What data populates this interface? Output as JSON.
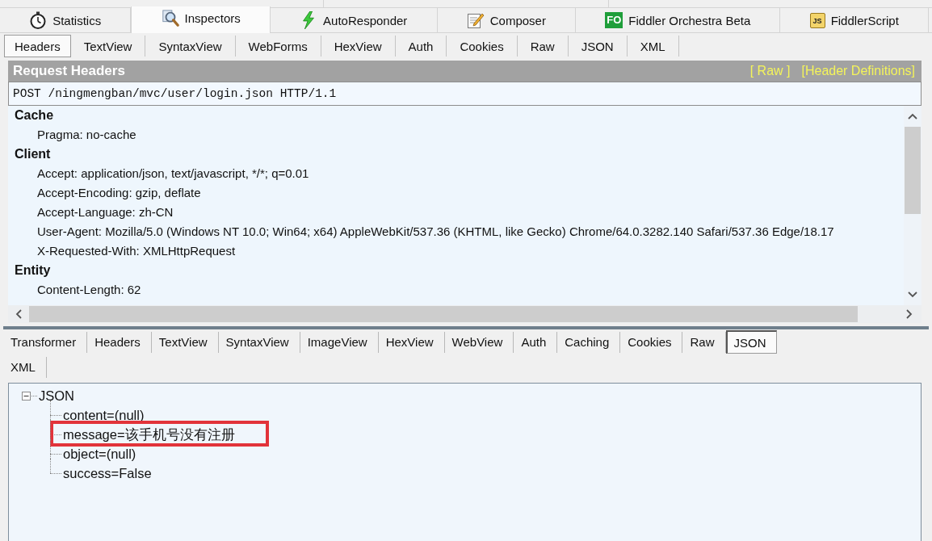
{
  "main_tabs": [
    {
      "label": "Statistics",
      "selected": false
    },
    {
      "label": "Inspectors",
      "selected": true
    },
    {
      "label": "AutoResponder",
      "selected": false
    },
    {
      "label": "Composer",
      "selected": false
    },
    {
      "label": "Fiddler Orchestra Beta",
      "badge": "FO",
      "selected": false
    },
    {
      "label": "FiddlerScript",
      "badge": "JS",
      "selected": false
    }
  ],
  "request_tabs": [
    {
      "label": "Headers",
      "selected": true
    },
    {
      "label": "TextView",
      "selected": false
    },
    {
      "label": "SyntaxView",
      "selected": false
    },
    {
      "label": "WebForms",
      "selected": false
    },
    {
      "label": "HexView",
      "selected": false
    },
    {
      "label": "Auth",
      "selected": false
    },
    {
      "label": "Cookies",
      "selected": false
    },
    {
      "label": "Raw",
      "selected": false
    },
    {
      "label": "JSON",
      "selected": false
    },
    {
      "label": "XML",
      "selected": false
    }
  ],
  "request_headers": {
    "title": "Request Headers",
    "links": [
      "[ Raw ]",
      "[Header Definitions]"
    ],
    "request_line": "POST /ningmengban/mvc/user/login.json HTTP/1.1",
    "groups": [
      {
        "name": "Cache",
        "headers": [
          "Pragma: no-cache"
        ]
      },
      {
        "name": "Client",
        "headers": [
          "Accept: application/json, text/javascript, */*; q=0.01",
          "Accept-Encoding: gzip, deflate",
          "Accept-Language: zh-CN",
          "User-Agent: Mozilla/5.0 (Windows NT 10.0; Win64; x64) AppleWebKit/537.36 (KHTML, like Gecko) Chrome/64.0.3282.140 Safari/537.36 Edge/18.17",
          "X-Requested-With: XMLHttpRequest"
        ]
      },
      {
        "name": "Entity",
        "headers": [
          "Content-Length: 62"
        ]
      }
    ]
  },
  "response_tabs": [
    {
      "tabs": [
        {
          "label": "Transformer",
          "selected": false
        },
        {
          "label": "Headers",
          "selected": false
        },
        {
          "label": "TextView",
          "selected": false
        },
        {
          "label": "SyntaxView",
          "selected": false
        },
        {
          "label": "ImageView",
          "selected": false
        },
        {
          "label": "HexView",
          "selected": false
        },
        {
          "label": "WebView",
          "selected": false
        },
        {
          "label": "Auth",
          "selected": false
        },
        {
          "label": "Caching",
          "selected": false
        },
        {
          "label": "Cookies",
          "selected": false
        },
        {
          "label": "Raw",
          "selected": false
        },
        {
          "label": "JSON",
          "selected": true
        }
      ]
    },
    {
      "tabs": [
        {
          "label": "XML",
          "selected": false
        }
      ]
    }
  ],
  "json_tree": {
    "label": "JSON",
    "expanded": true,
    "children": [
      {
        "label": "content=(null)",
        "highlighted": false
      },
      {
        "label": "message=该手机号没有注册",
        "highlighted": true
      },
      {
        "label": "object=(null)",
        "highlighted": false
      },
      {
        "label": "success=False",
        "highlighted": false
      }
    ]
  }
}
